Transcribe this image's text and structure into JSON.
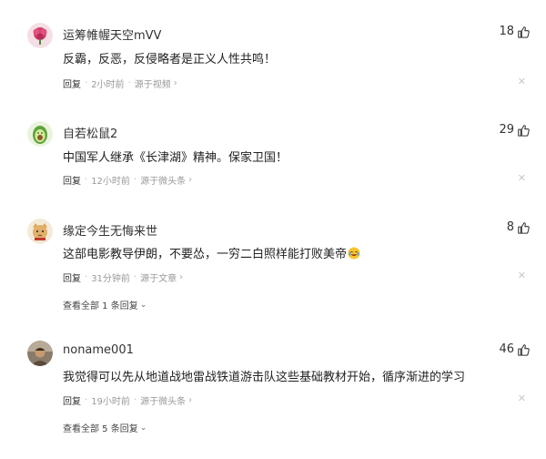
{
  "comments": [
    {
      "username": "运筹帷幄天空mVV",
      "text": "反霸，反恶，反侵略者是正义人性共鸣！",
      "likes": "18",
      "reply_label": "回复",
      "time": "2小时前",
      "source": "源于视频",
      "avatar_icon": "pink-flower-avatar"
    },
    {
      "username": "自若松鼠2",
      "text": "中国军人继承《长津湖》精神。保家卫国！",
      "likes": "29",
      "reply_label": "回复",
      "time": "12小时前",
      "source": "源于微头条",
      "avatar_icon": "avocado-avatar"
    },
    {
      "username": "缘定今生无悔来世",
      "text": "这部电影教导伊朗，不要怂，一穷二白照样能打败美帝",
      "likes": "8",
      "reply_label": "回复",
      "time": "31分钟前",
      "source": "源于文章",
      "view_replies": "查看全部 1 条回复",
      "avatar_icon": "cat-avatar",
      "trailing_emoji": "laughing-crying-emoji"
    },
    {
      "username": "noname001",
      "text": "我觉得可以先从地道战地雷战铁道游击队这些基础教材开始，循序渐进的学习",
      "likes": "46",
      "reply_label": "回复",
      "time": "19小时前",
      "source": "源于微头条",
      "view_replies": "查看全部 5 条回复",
      "avatar_icon": "person-photo-avatar"
    }
  ],
  "icons": {
    "like": "thumbs-up-icon",
    "close": "close-icon",
    "chevron": "chevron-right-icon",
    "expand": "chevron-down-icon"
  },
  "colors": {
    "meta_text": "#999999",
    "close_icon": "#c8c8c8"
  }
}
